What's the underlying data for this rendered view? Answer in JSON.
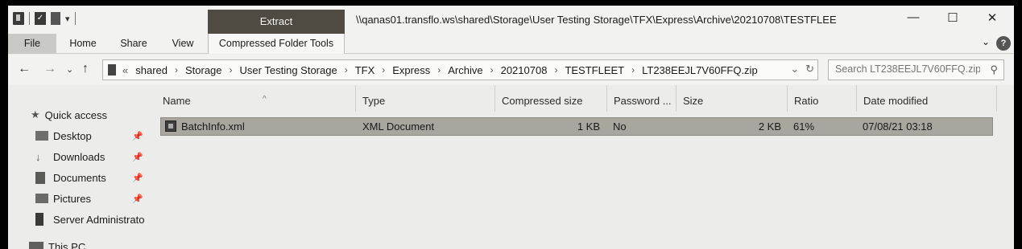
{
  "titlebar": {
    "context_tab": "Extract",
    "path": "\\\\qanas01.transflo.ws\\shared\\Storage\\User Testing Storage\\TFX\\Express\\Archive\\20210708\\TESTFLEE",
    "minimize": "—",
    "maximize": "☐",
    "close": "✕"
  },
  "ribbon": {
    "tabs": [
      "File",
      "Home",
      "Share",
      "View",
      "Compressed Folder Tools"
    ],
    "help": "?",
    "collapse": "⌄"
  },
  "address": {
    "overflow": "«",
    "crumbs": [
      "shared",
      "Storage",
      "User Testing Storage",
      "TFX",
      "Express",
      "Archive",
      "20210708",
      "TESTFLEET",
      "LT238EEJL7V60FFQ.zip"
    ],
    "separator": "›",
    "dropdown": "⌄",
    "refresh": "↻"
  },
  "search": {
    "placeholder": "Search LT238EEJL7V60FFQ.zip"
  },
  "navpane": {
    "quick_access": "Quick access",
    "items": [
      {
        "label": "Desktop",
        "pinned": true
      },
      {
        "label": "Downloads",
        "pinned": true
      },
      {
        "label": "Documents",
        "pinned": true
      },
      {
        "label": "Pictures",
        "pinned": true
      },
      {
        "label": "Server Administrato",
        "pinned": false
      }
    ],
    "this_pc": "This PC"
  },
  "columns": [
    "Name",
    "Type",
    "Compressed size",
    "Password ...",
    "Size",
    "Ratio",
    "Date modified"
  ],
  "files": [
    {
      "name": "BatchInfo.xml",
      "type": "XML Document",
      "compressed_size": "1 KB",
      "password": "No",
      "size": "2 KB",
      "ratio": "61%",
      "date_modified": "07/08/21 03:18"
    }
  ]
}
